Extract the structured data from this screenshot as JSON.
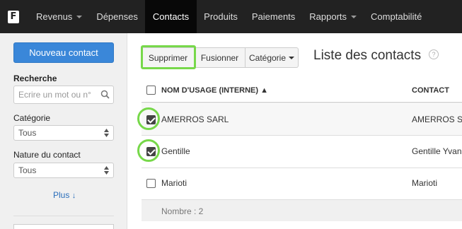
{
  "navbar": {
    "logo_letter": "F",
    "items": [
      {
        "label": "Revenus",
        "has_caret": true
      },
      {
        "label": "Dépenses",
        "has_caret": false
      },
      {
        "label": "Contacts",
        "has_caret": false,
        "active": true
      },
      {
        "label": "Produits",
        "has_caret": false
      },
      {
        "label": "Paiements",
        "has_caret": false
      },
      {
        "label": "Rapports",
        "has_caret": true
      },
      {
        "label": "Comptabilité",
        "has_caret": false
      }
    ]
  },
  "sidebar": {
    "new_contact_label": "Nouveau contact",
    "search_label": "Recherche",
    "search_placeholder": "Ecrire un mot ou n°",
    "category_label": "Catégorie",
    "category_value": "Tous",
    "nature_label": "Nature du contact",
    "nature_value": "Tous",
    "more_label": "Plus",
    "more_arrow": "↓"
  },
  "toolbar": {
    "delete_label": "Supprimer",
    "merge_label": "Fusionner",
    "category_label": "Catégorie"
  },
  "main": {
    "title": "Liste des contacts",
    "help_glyph": "?"
  },
  "table": {
    "headers": {
      "name": "NOM D'USAGE (INTERNE) ▲",
      "contact": "CONTACT"
    },
    "rows": [
      {
        "name": "AMERROS SARL",
        "contact": "AMERROS S",
        "checked": true
      },
      {
        "name": "Gentille",
        "contact": "Gentille Yvan",
        "checked": true
      },
      {
        "name": "Marioti",
        "contact": "Marioti",
        "checked": false
      }
    ],
    "footer": "Nombre : 2"
  },
  "colors": {
    "navbar_bg": "#222222",
    "primary_button": "#3a87d9",
    "highlight": "#77d84a"
  }
}
